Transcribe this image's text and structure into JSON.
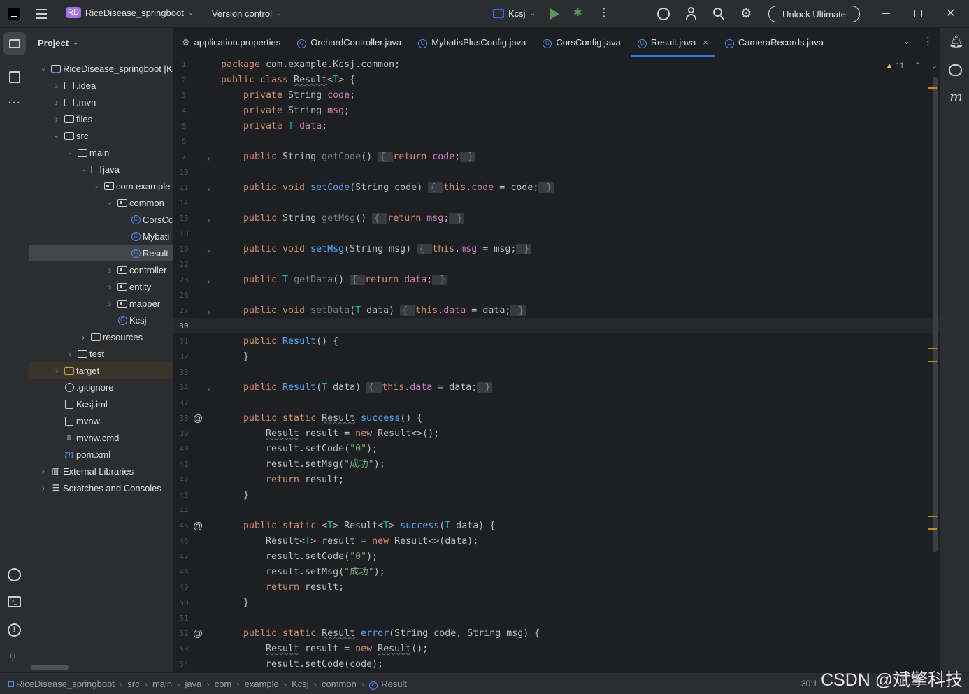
{
  "titlebar": {
    "app_icon": "intellij-logo-icon",
    "project_badge": "RD",
    "project_name": "RiceDisease_springboot",
    "vcs": "Version control",
    "run_config": "Kcsj",
    "unlock": "Unlock Ultimate"
  },
  "project_panel": {
    "title": "Project",
    "items": [
      {
        "label": "RiceDisease_springboot [K"
      },
      {
        "label": ".idea"
      },
      {
        "label": ".mvn"
      },
      {
        "label": "files"
      },
      {
        "label": "src"
      },
      {
        "label": "main"
      },
      {
        "label": "java"
      },
      {
        "label": "com.example"
      },
      {
        "label": "common"
      },
      {
        "label": "CorsCc"
      },
      {
        "label": "Mybati"
      },
      {
        "label": "Result"
      },
      {
        "label": "controller"
      },
      {
        "label": "entity"
      },
      {
        "label": "mapper"
      },
      {
        "label": "Kcsj"
      },
      {
        "label": "resources"
      },
      {
        "label": "test"
      },
      {
        "label": "target"
      },
      {
        "label": ".gitignore"
      },
      {
        "label": "Kcsj.iml"
      },
      {
        "label": "mvnw"
      },
      {
        "label": "mvnw.cmd"
      },
      {
        "label": "pom.xml"
      },
      {
        "label": "External Libraries"
      },
      {
        "label": "Scratches and Consoles"
      }
    ]
  },
  "tabs": [
    {
      "label": "application.properties",
      "icon": "gear-icon"
    },
    {
      "label": "OrchardController.java",
      "icon": "class-icon"
    },
    {
      "label": "MybatisPlusConfig.java",
      "icon": "class-icon"
    },
    {
      "label": "CorsConfig.java",
      "icon": "class-icon"
    },
    {
      "label": "Result.java",
      "icon": "class-icon",
      "active": true
    },
    {
      "label": "CameraRecords.java",
      "icon": "class-icon"
    }
  ],
  "editor": {
    "warnings": "11",
    "line_numbers": [
      "1",
      "2",
      "3",
      "4",
      "5",
      "6",
      "7",
      "10",
      "11",
      "14",
      "15",
      "18",
      "19",
      "22",
      "23",
      "26",
      "27",
      "30",
      "31",
      "32",
      "33",
      "34",
      "37",
      "38",
      "39",
      "40",
      "41",
      "42",
      "43",
      "44",
      "45",
      "46",
      "47",
      "48",
      "49",
      "50",
      "51",
      "52",
      "53",
      "54"
    ]
  },
  "code": {
    "l1_pkg": "package",
    "l1_rest": " com.example.Kcsj.common;",
    "l2": [
      "public class ",
      "Result",
      "<",
      "T",
      "> {"
    ],
    "l3": [
      "private ",
      "String ",
      "code",
      ";"
    ],
    "l4": [
      "private ",
      "String ",
      "msg",
      ";"
    ],
    "l5": [
      "private ",
      "T ",
      "data",
      ";"
    ],
    "get_code": [
      "public ",
      "String ",
      "getCode",
      "() ",
      "{ ",
      "return ",
      "code",
      ";",
      " }"
    ],
    "set_code": [
      "public void ",
      "setCode",
      "(String code) ",
      "{ ",
      "this",
      ".",
      "code",
      " = code;",
      " }"
    ],
    "get_msg": [
      "public ",
      "String ",
      "getMsg",
      "() ",
      "{ ",
      "return ",
      "msg",
      ";",
      " }"
    ],
    "set_msg": [
      "public void ",
      "setMsg",
      "(String msg) ",
      "{ ",
      "this",
      ".",
      "msg",
      " = msg;",
      " }"
    ],
    "get_data": [
      "public ",
      "T ",
      "getData",
      "() ",
      "{ ",
      "return ",
      "data",
      ";",
      " }"
    ],
    "set_data": [
      "public void ",
      "setData",
      "(",
      "T",
      " data) ",
      "{ ",
      "this",
      ".",
      "data",
      " = data;",
      " }"
    ],
    "ctor1": [
      "public ",
      "Result",
      "() {"
    ],
    "close": "}",
    "ctor2": [
      "public ",
      "Result",
      "(",
      "T",
      " data) ",
      "{ ",
      "this",
      ".",
      "data",
      " = data;",
      " }"
    ],
    "succ1": [
      "public static ",
      "Result",
      " ",
      "success",
      "() {"
    ],
    "succ1_l1": [
      "Result",
      " result = ",
      "new ",
      "Result<>();"
    ],
    "succ1_l2": [
      "result.setCode(",
      "\"0\"",
      ");"
    ],
    "succ1_l3": [
      "result.setMsg(",
      "\"成功\"",
      ");"
    ],
    "ret": [
      "return ",
      "result;"
    ],
    "succ2": [
      "public static ",
      "<",
      "T",
      "> Result<",
      "T",
      "> ",
      "success",
      "(",
      "T",
      " data) {"
    ],
    "succ2_l1": [
      "Result<",
      "T",
      "> result = ",
      "new ",
      "Result<>(data);"
    ],
    "err": [
      "public static ",
      "Result",
      " ",
      "error",
      "(String code, String msg) {"
    ],
    "err_l1": [
      "Result",
      " result = ",
      "new ",
      "Result",
      "();"
    ],
    "err_l2": "result.setCode(code);"
  },
  "statusbar": {
    "crumbs": [
      "RiceDisease_springboot",
      "src",
      "main",
      "java",
      "com",
      "example",
      "Kcsj",
      "common",
      "Result"
    ],
    "position": "30:1",
    "watermark": "CSDN @斌擎科技"
  }
}
